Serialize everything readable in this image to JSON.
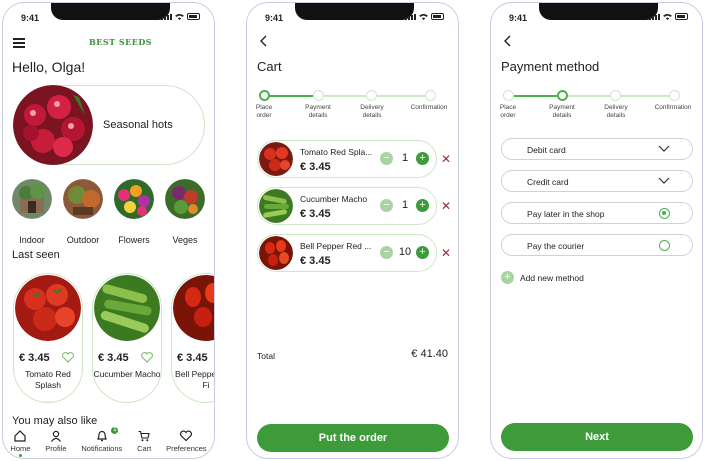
{
  "status_time": "9:41",
  "colors": {
    "primary": "#3d9b3a",
    "accent_light": "#a9d3a2",
    "remove": "#9b2a3a"
  },
  "home": {
    "logo": "BEST SEEDS",
    "greeting": "Hello, Olga!",
    "banner": {
      "label": "Seasonal hots"
    },
    "categories": [
      {
        "label": "Indoor"
      },
      {
        "label": "Outdoor"
      },
      {
        "label": "Flowers"
      },
      {
        "label": "Veges"
      }
    ],
    "last_seen_title": "Last seen",
    "last_seen": [
      {
        "price": "€ 3.45",
        "name": "Tomato Red Splash"
      },
      {
        "price": "€ 3.45",
        "name": "Cucumber Macho"
      },
      {
        "price": "€ 3.45",
        "name": "Bell Pepper Red Fi"
      }
    ],
    "also_like_title": "You may also like",
    "nav": [
      {
        "label": "Home",
        "icon": "home-icon"
      },
      {
        "label": "Profile",
        "icon": "profile-icon"
      },
      {
        "label": "Notifications",
        "icon": "bell-icon",
        "badge": "1"
      },
      {
        "label": "Cart",
        "icon": "cart-icon"
      },
      {
        "label": "Preferences",
        "icon": "heart-icon"
      }
    ]
  },
  "cart": {
    "title": "Cart",
    "steps": [
      "Place order",
      "Payment details",
      "Delivery details",
      "Confirmation"
    ],
    "items": [
      {
        "name": "Tomato Red Spla...",
        "price": "€ 3.45",
        "qty": "1"
      },
      {
        "name": "Cucumber Macho",
        "price": "€ 3.45",
        "qty": "1"
      },
      {
        "name": "Bell Pepper Red ...",
        "price": "€ 3.45",
        "qty": "10"
      }
    ],
    "total_label": "Total",
    "total_value": "€ 41.40",
    "cta": "Put the order"
  },
  "payment": {
    "title": "Payment method",
    "steps": [
      "Place order",
      "Payment details",
      "Delivery details",
      "Confirmation"
    ],
    "options": [
      {
        "label": "Debit card",
        "control": "chevron"
      },
      {
        "label": "Credit card",
        "control": "chevron"
      },
      {
        "label": "Pay later in the shop",
        "control": "radio",
        "selected": true
      },
      {
        "label": "Pay the courier",
        "control": "radio",
        "selected": false
      }
    ],
    "add_method": "Add new method",
    "cta": "Next"
  }
}
